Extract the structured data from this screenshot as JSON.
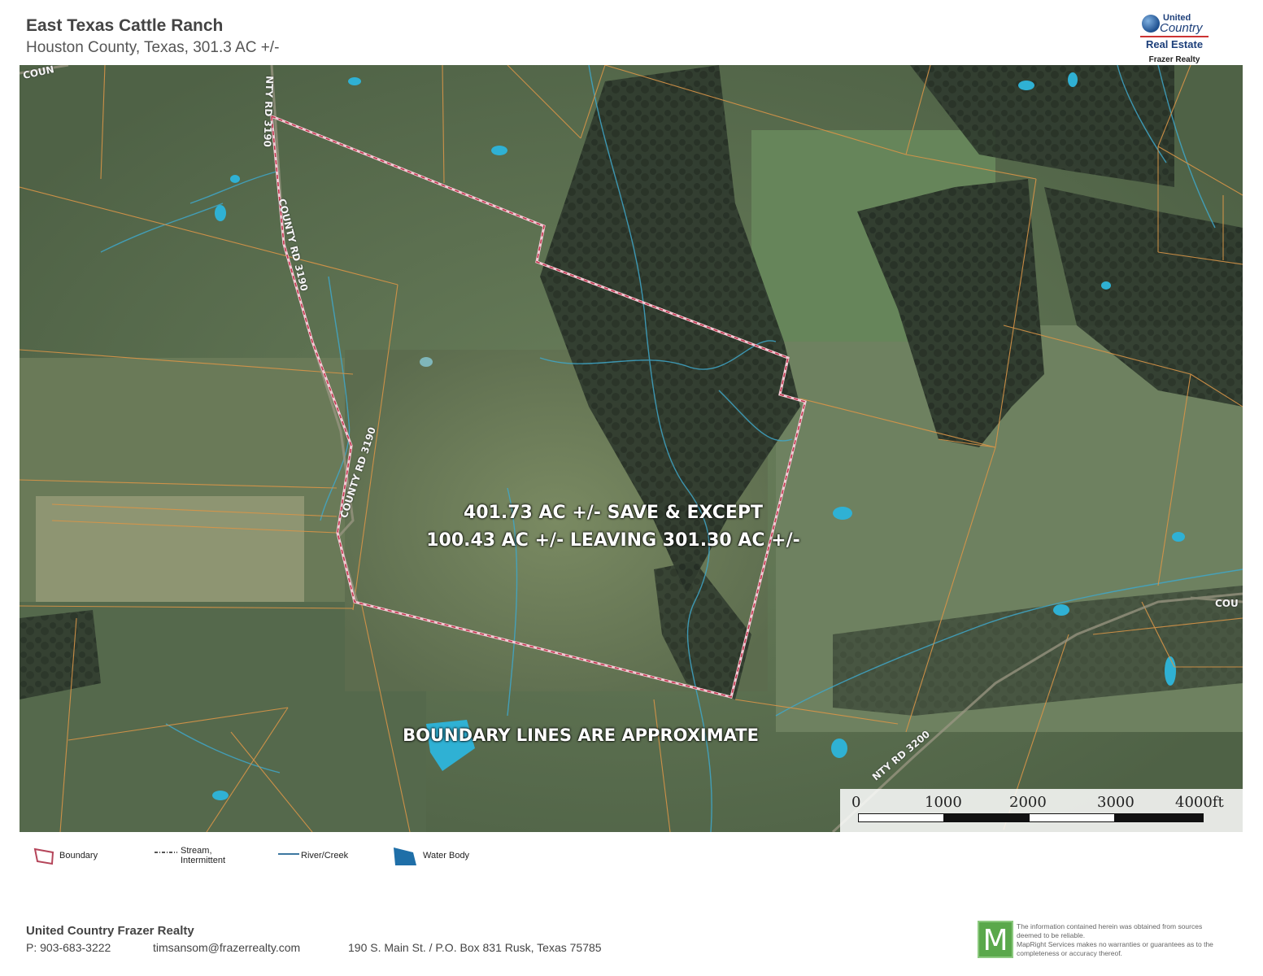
{
  "header": {
    "title": "East Texas Cattle Ranch",
    "subtitle": "Houston County, Texas, 301.3 AC +/-"
  },
  "logo": {
    "line1": "United",
    "line2": "Country",
    "line3": "Real Estate",
    "line4": "Frazer Realty"
  },
  "map": {
    "annotation_line1": "401.73 AC +/- SAVE & EXCEPT",
    "annotation_line2": "100.43 AC +/- LEAVING 301.30 AC +/-",
    "disclaimer_note": "BOUNDARY LINES ARE APPROXIMATE",
    "road_labels": {
      "top_left": "COUN",
      "north": "NTY RD 3190",
      "mid": "COUNTY RD 3190",
      "south": "COUNTY RD 3190",
      "east_edge": "COU",
      "southeast": "NTY RD 3200"
    },
    "colors": {
      "boundary": "#f3c9d3",
      "boundary_dash": "#c0304a",
      "parcel_lines": "#d99548",
      "streams": "#3fa7c9",
      "water": "#2fb1d4"
    }
  },
  "scale_bar": {
    "labels": [
      "0",
      "1000",
      "2000",
      "3000",
      "4000ft"
    ]
  },
  "legend": {
    "boundary": "Boundary",
    "stream_line1": "Stream,",
    "stream_line2": "Intermittent",
    "river": "River/Creek",
    "water": "Water Body"
  },
  "footer": {
    "company": "United Country Frazer Realty",
    "phone": "P: 903-683-3222",
    "email": "timsansom@frazerrealty.com",
    "address": "190 S. Main St. / P.O. Box 831 Rusk, Texas 75785",
    "disclaimer_line1": "The information contained herein was obtained from sources",
    "disclaimer_line2": "deemed to be reliable.",
    "disclaimer_line3": "MapRight Services makes no warranties or guarantees as to the",
    "disclaimer_line4": "completeness or accuracy thereof.",
    "mapright_logo_letter": "M"
  }
}
